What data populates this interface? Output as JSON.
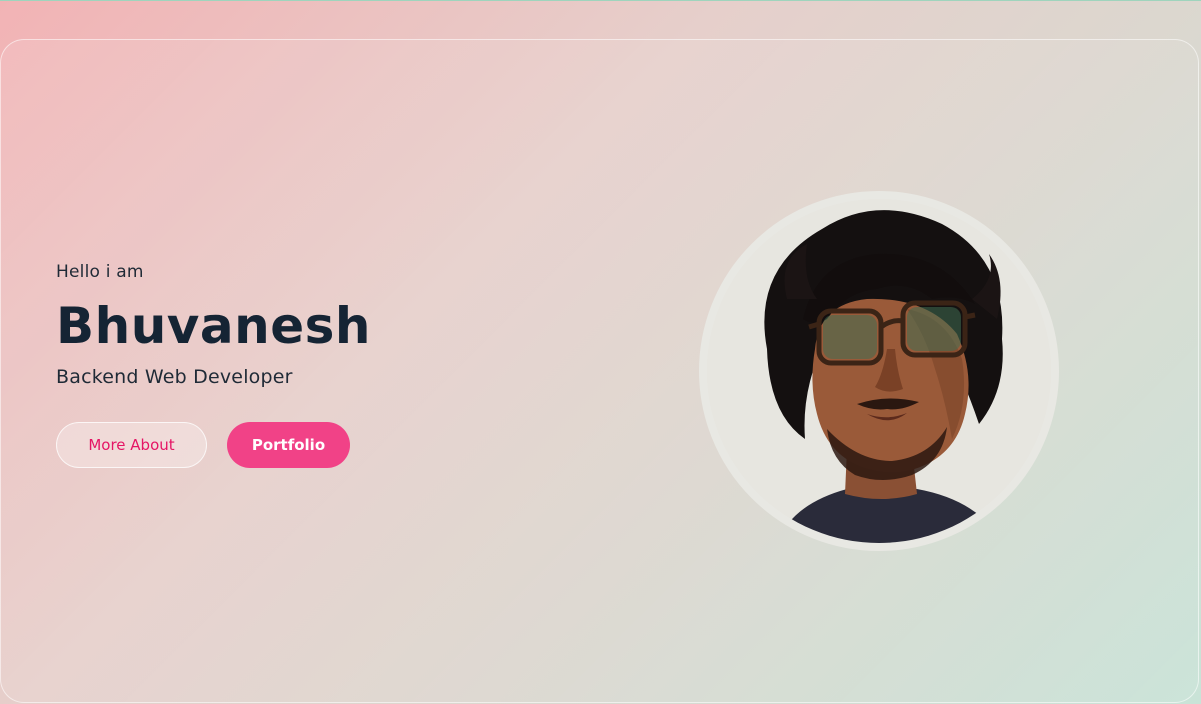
{
  "hero": {
    "greeting": "Hello i am",
    "name": "Bhuvanesh",
    "role": "Backend Web Developer",
    "buttons": {
      "more_about": "More About",
      "portfolio": "Portfolio"
    },
    "profile_image_alt": "Bhuvanesh profile photo"
  },
  "colors": {
    "accent": "#f14287",
    "accent_text": "#e51565",
    "heading": "#152434",
    "bg_start": "#f2b3b5",
    "bg_end": "#c9e3d7"
  },
  "icons": {
    "avatar": "profile-photo"
  }
}
